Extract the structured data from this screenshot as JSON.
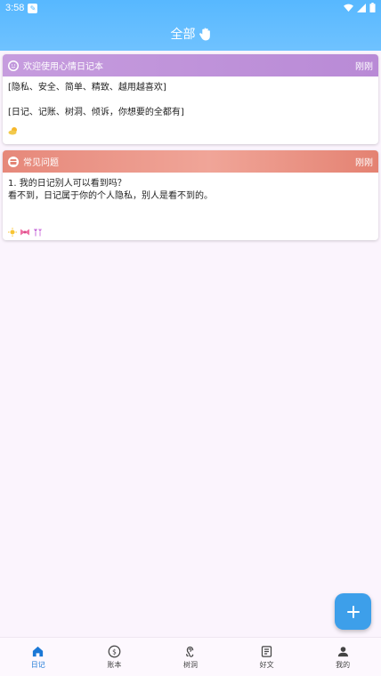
{
  "status_bar": {
    "time": "3:58"
  },
  "header": {
    "title": "全部"
  },
  "cards": [
    {
      "head_title": "欢迎使用心情日记本",
      "time": "刚刚",
      "lines": [
        "[隐私、安全、简单、精致、越用越喜欢]",
        "",
        "[日记、记账、树洞、倾诉，你想要的全都有]"
      ],
      "head_color": "#c497dd"
    },
    {
      "head_title": "常见问题",
      "time": "刚刚",
      "lines": [
        "1. 我的日记别人可以看到吗？",
        "看不到，日记属于你的个人隐私，别人是看不到的。"
      ],
      "head_color": "#e48678"
    }
  ],
  "fab": {
    "icon": "plus-icon"
  },
  "nav": [
    {
      "label": "日记",
      "icon": "home-icon",
      "active": true
    },
    {
      "label": "账本",
      "icon": "dollar-icon",
      "active": false
    },
    {
      "label": "树洞",
      "icon": "ear-icon",
      "active": false
    },
    {
      "label": "好文",
      "icon": "article-icon",
      "active": false
    },
    {
      "label": "我的",
      "icon": "person-icon",
      "active": false
    }
  ],
  "colors": {
    "header": "#5ab9ff",
    "accent": "#1b78d6",
    "fab": "#3d9fea",
    "background": "#fbf4fd"
  }
}
